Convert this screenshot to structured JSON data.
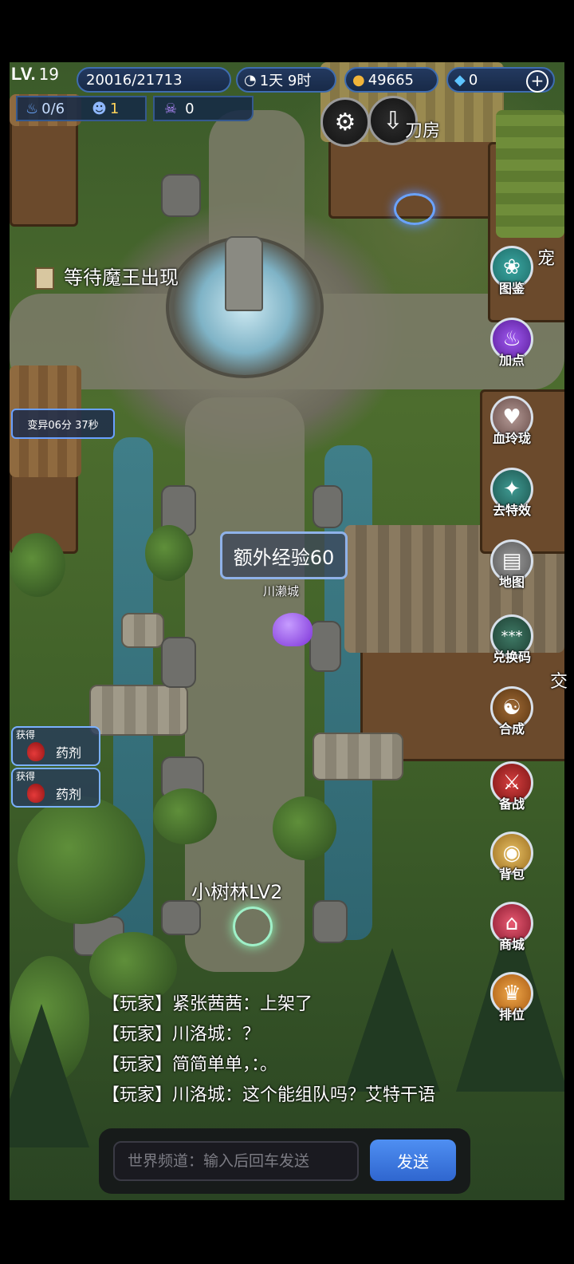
{
  "hud": {
    "level_prefix": "LV.",
    "level": "19",
    "exp": "20016/21713",
    "time": "1天 9时",
    "gold": "49665",
    "diamond": "0",
    "add_icon": "plus-icon",
    "stamina": "0/6",
    "stat_b": "1",
    "stat_c": "0"
  },
  "scene": {
    "building_top": "刀房",
    "boss_notice": "等待魔王出现",
    "mutate_timer": "变异06分 37秒",
    "exp_bonus": "额外经验60",
    "town_name": "川濑城",
    "area_name": "小树林LV2",
    "right_edge_text_1": "宠",
    "right_edge_text_2": "交",
    "rewards": [
      {
        "got": "获得",
        "name": "药剂"
      },
      {
        "got": "获得",
        "name": "药剂"
      }
    ]
  },
  "side_menu": [
    {
      "label": "图鉴",
      "icon": "paw-icon",
      "color": "#2f8f8a"
    },
    {
      "label": "加点",
      "icon": "flame-icon",
      "color": "#7a35c9"
    },
    {
      "label": "血玲珑",
      "icon": "heart-icon",
      "color": "#8a6a66"
    },
    {
      "label": "去特效",
      "icon": "magic-wand-icon",
      "color": "#2f6f6a"
    },
    {
      "label": "地图",
      "icon": "map-icon",
      "color": "#7a7a7a"
    },
    {
      "label": "兑换码",
      "icon": "code-icon",
      "color": "#2f5b4a"
    },
    {
      "label": "合成",
      "icon": "yin-yang-icon",
      "color": "#7a4a22"
    },
    {
      "label": "备战",
      "icon": "crossed-swords-icon",
      "color": "#b02a2a"
    },
    {
      "label": "背包",
      "icon": "bag-icon",
      "color": "#c79a3a"
    },
    {
      "label": "商城",
      "icon": "shop-icon",
      "color": "#c22f4a"
    },
    {
      "label": "排位",
      "icon": "crown-icon",
      "color": "#d98a2a"
    }
  ],
  "chat": {
    "messages": [
      "【玩家】紧张茜茜：上架了",
      "【玩家】川洛城：？",
      "【玩家】简简单单，：。",
      "【玩家】川洛城：这个能组队吗？艾特干语"
    ],
    "placeholder": "世界频道：输入后回车发送",
    "send_label": "发送"
  },
  "colors": {
    "hud_bg": "#1c2f52",
    "hud_border": "#3f6db0",
    "send_button": "#3f7fe3"
  }
}
